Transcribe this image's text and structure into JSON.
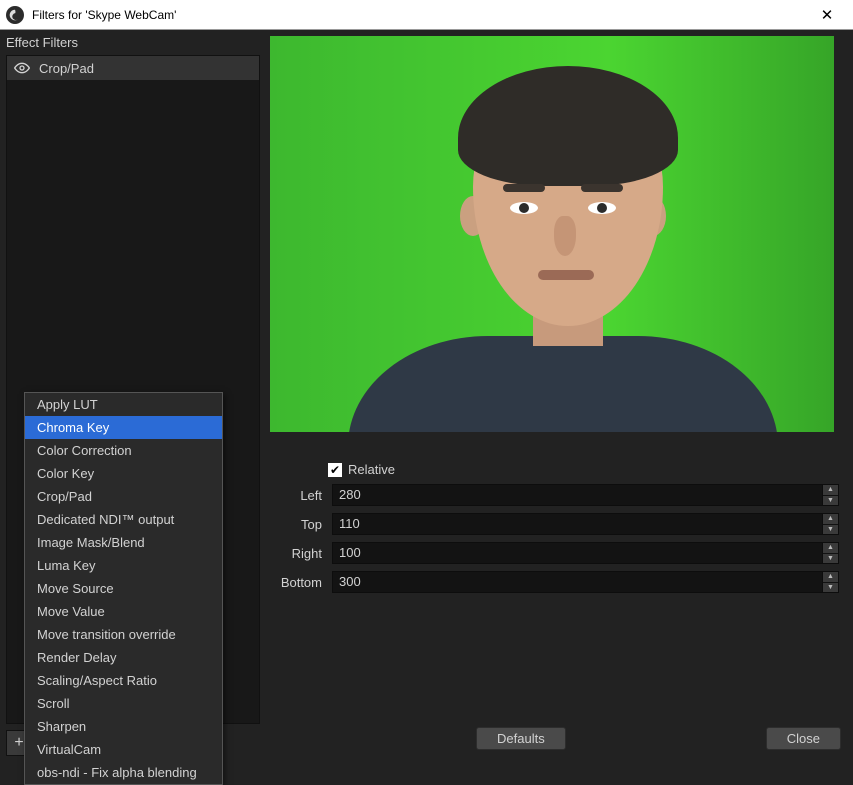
{
  "window": {
    "title": "Filters for 'Skype WebCam'"
  },
  "sidebar": {
    "section_label": "Effect Filters",
    "items": [
      {
        "name": "Crop/Pad"
      }
    ]
  },
  "properties": {
    "relative": {
      "label": "Relative",
      "checked": true
    },
    "fields": {
      "left": {
        "label": "Left",
        "value": "280"
      },
      "top": {
        "label": "Top",
        "value": "110"
      },
      "right": {
        "label": "Right",
        "value": "100"
      },
      "bottom": {
        "label": "Bottom",
        "value": "300"
      }
    }
  },
  "buttons": {
    "defaults": "Defaults",
    "close": "Close"
  },
  "context_menu": {
    "highlighted_index": 1,
    "items": [
      "Apply LUT",
      "Chroma Key",
      "Color Correction",
      "Color Key",
      "Crop/Pad",
      "Dedicated NDI™ output",
      "Image Mask/Blend",
      "Luma Key",
      "Move Source",
      "Move Value",
      "Move transition override",
      "Render Delay",
      "Scaling/Aspect Ratio",
      "Scroll",
      "Sharpen",
      "VirtualCam",
      "obs-ndi - Fix alpha blending"
    ]
  }
}
